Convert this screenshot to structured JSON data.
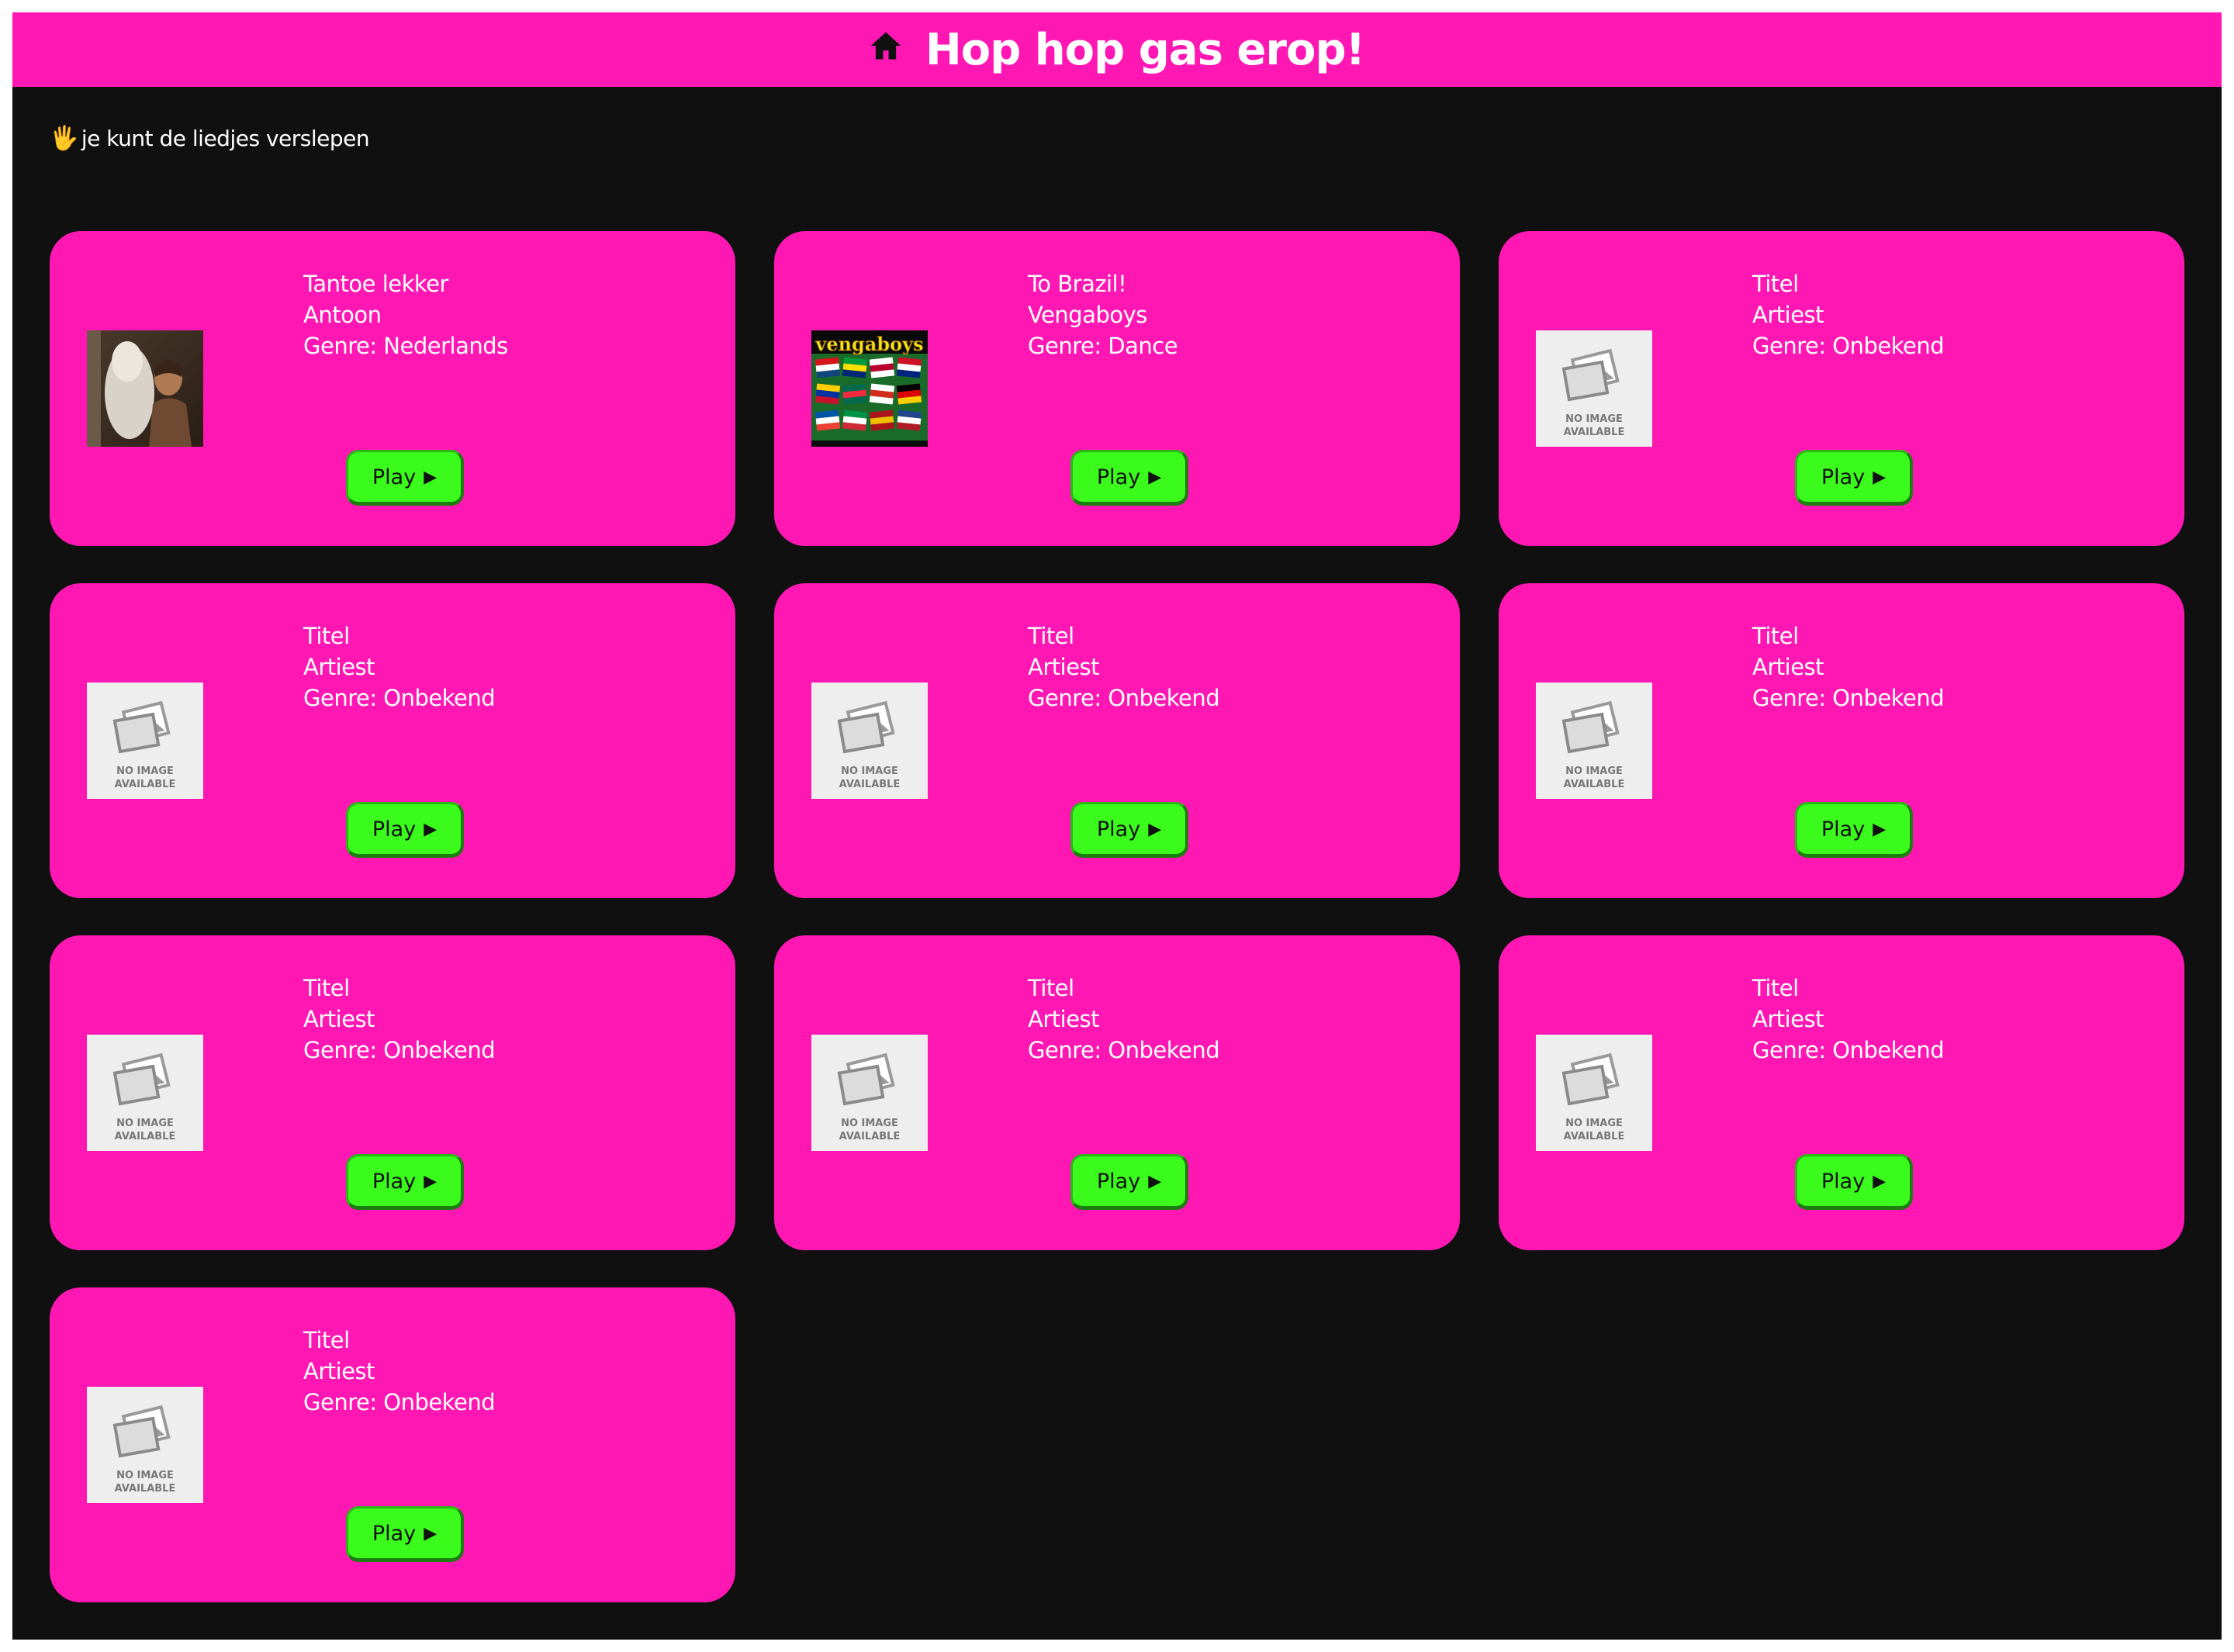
{
  "header": {
    "icon": "home-icon",
    "title": "Hop hop gas erop!"
  },
  "hint": {
    "icon": "raised-hand-icon",
    "emoji": "🖐",
    "text": "je kunt de liedjes verslepen"
  },
  "no_image": {
    "line1": "NO IMAGE",
    "line2": "AVAILABLE"
  },
  "colors": {
    "header_bg": "#ff17b4",
    "card_bg": "#ff17b4",
    "page_bg": "#101010",
    "play_button": "#3afb1c"
  },
  "songs": [
    {
      "title": "Tantoe lekker",
      "artist": "Antoon",
      "genre": "Genre: Nederlands",
      "cover": "photo-portrait",
      "play_label": "Play",
      "play_icon": "▶"
    },
    {
      "title": "To Brazil!",
      "artist": "Vengaboys",
      "genre": "Genre: Dance",
      "cover": "vengaboys",
      "cover_text": "vengaboys",
      "play_label": "Play",
      "play_icon": "▶"
    },
    {
      "title": "Titel",
      "artist": "Artiest",
      "genre": "Genre: Onbekend",
      "cover": "no-image",
      "play_label": "Play",
      "play_icon": "▶"
    },
    {
      "title": "Titel",
      "artist": "Artiest",
      "genre": "Genre: Onbekend",
      "cover": "no-image",
      "play_label": "Play",
      "play_icon": "▶"
    },
    {
      "title": "Titel",
      "artist": "Artiest",
      "genre": "Genre: Onbekend",
      "cover": "no-image",
      "play_label": "Play",
      "play_icon": "▶"
    },
    {
      "title": "Titel",
      "artist": "Artiest",
      "genre": "Genre: Onbekend",
      "cover": "no-image",
      "play_label": "Play",
      "play_icon": "▶"
    },
    {
      "title": "Titel",
      "artist": "Artiest",
      "genre": "Genre: Onbekend",
      "cover": "no-image",
      "play_label": "Play",
      "play_icon": "▶"
    },
    {
      "title": "Titel",
      "artist": "Artiest",
      "genre": "Genre: Onbekend",
      "cover": "no-image",
      "play_label": "Play",
      "play_icon": "▶"
    },
    {
      "title": "Titel",
      "artist": "Artiest",
      "genre": "Genre: Onbekend",
      "cover": "no-image",
      "play_label": "Play",
      "play_icon": "▶"
    },
    {
      "title": "Titel",
      "artist": "Artiest",
      "genre": "Genre: Onbekend",
      "cover": "no-image",
      "play_label": "Play",
      "play_icon": "▶"
    }
  ]
}
